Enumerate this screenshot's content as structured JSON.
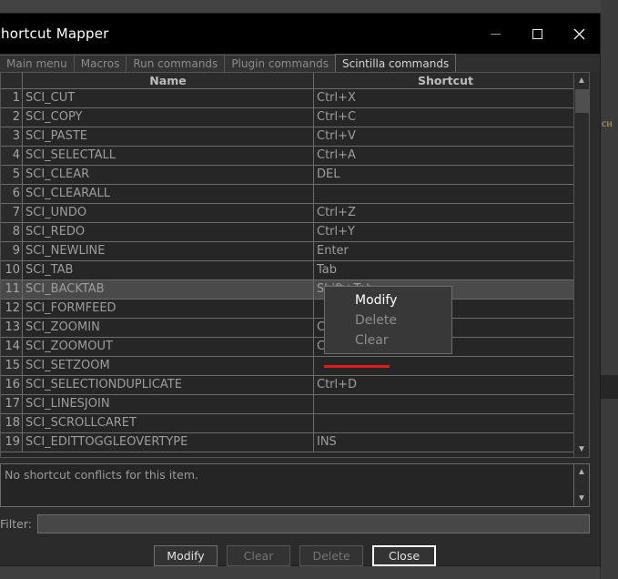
{
  "window": {
    "title": "hortcut Mapper",
    "controls": {
      "minimize": "minimize",
      "maximize": "maximize",
      "close": "close"
    }
  },
  "tabs": [
    {
      "label": "Main menu",
      "active": false
    },
    {
      "label": "Macros",
      "active": false
    },
    {
      "label": "Run commands",
      "active": false
    },
    {
      "label": "Plugin commands",
      "active": false
    },
    {
      "label": "Scintilla commands",
      "active": true
    }
  ],
  "table": {
    "columns": [
      "",
      "Name",
      "Shortcut"
    ],
    "selected_index": 10,
    "rows": [
      {
        "num": "1",
        "name": "SCI_CUT",
        "shortcut": "Ctrl+X"
      },
      {
        "num": "2",
        "name": "SCI_COPY",
        "shortcut": "Ctrl+C"
      },
      {
        "num": "3",
        "name": "SCI_PASTE",
        "shortcut": "Ctrl+V"
      },
      {
        "num": "4",
        "name": "SCI_SELECTALL",
        "shortcut": "Ctrl+A"
      },
      {
        "num": "5",
        "name": "SCI_CLEAR",
        "shortcut": "DEL"
      },
      {
        "num": "6",
        "name": "SCI_CLEARALL",
        "shortcut": ""
      },
      {
        "num": "7",
        "name": "SCI_UNDO",
        "shortcut": "Ctrl+Z"
      },
      {
        "num": "8",
        "name": "SCI_REDO",
        "shortcut": "Ctrl+Y"
      },
      {
        "num": "9",
        "name": "SCI_NEWLINE",
        "shortcut": "Enter"
      },
      {
        "num": "10",
        "name": "SCI_TAB",
        "shortcut": "Tab"
      },
      {
        "num": "11",
        "name": "SCI_BACKTAB",
        "shortcut": "Shift+Tab"
      },
      {
        "num": "12",
        "name": "SCI_FORMFEED",
        "shortcut": ""
      },
      {
        "num": "13",
        "name": "SCI_ZOOMIN",
        "shortcut": "Ctrl+Num +"
      },
      {
        "num": "14",
        "name": "SCI_ZOOMOUT",
        "shortcut": "Ctrl+Num -"
      },
      {
        "num": "15",
        "name": "SCI_SETZOOM",
        "shortcut": ""
      },
      {
        "num": "16",
        "name": "SCI_SELECTIONDUPLICATE",
        "shortcut": "Ctrl+D"
      },
      {
        "num": "17",
        "name": "SCI_LINESJOIN",
        "shortcut": ""
      },
      {
        "num": "18",
        "name": "SCI_SCROLLCARET",
        "shortcut": ""
      },
      {
        "num": "19",
        "name": "SCI_EDITTOGGLEOVERTYPE",
        "shortcut": "INS"
      }
    ]
  },
  "conflict": {
    "message": "No shortcut conflicts for this item."
  },
  "filter": {
    "label": "Filter:",
    "value": "",
    "placeholder": ""
  },
  "buttons": [
    {
      "label": "Modify",
      "state": "normal"
    },
    {
      "label": "Clear",
      "state": "disabled"
    },
    {
      "label": "Delete",
      "state": "disabled"
    },
    {
      "label": "Close",
      "state": "focused"
    }
  ],
  "context_menu": {
    "items": [
      {
        "label": "Modify",
        "enabled": true
      },
      {
        "label": "Delete",
        "enabled": false
      },
      {
        "label": "Clear",
        "enabled": false
      }
    ],
    "highlight_color": "#e01b1b"
  },
  "background": {
    "text_sliver": "си"
  }
}
